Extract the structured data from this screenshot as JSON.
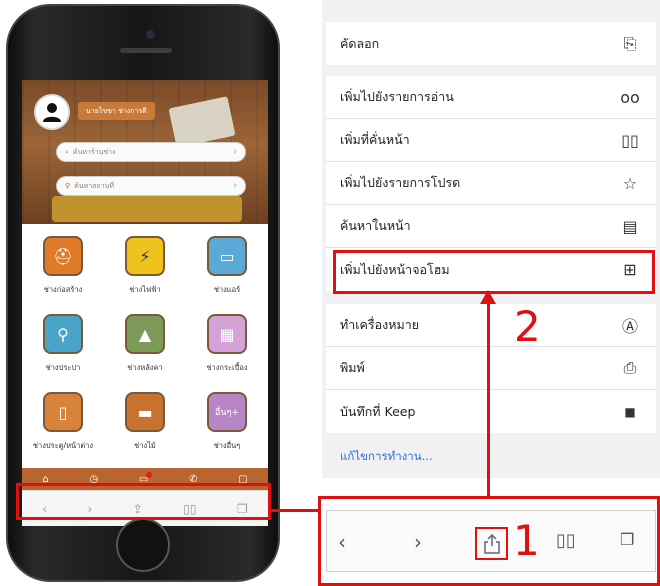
{
  "phone": {
    "user_name": "นายไขขา ช่างการดี",
    "search_shop_placeholder": "ค้นหาร้านช่าง",
    "search_location_placeholder": "ค้นหาสถานที่",
    "categories": [
      {
        "label": "ช่างก่อสร้าง",
        "icon": "helmet-icon",
        "color": "#e07b2a"
      },
      {
        "label": "ช่างไฟฟ้า",
        "icon": "lightning-icon",
        "color": "#f0c21e"
      },
      {
        "label": "ช่างแอร์",
        "icon": "air-conditioner-icon",
        "color": "#5aa9d6"
      },
      {
        "label": "ช่างประปา",
        "icon": "faucet-icon",
        "color": "#4aa3c9"
      },
      {
        "label": "ช่างหลังคา",
        "icon": "roof-icon",
        "color": "#7d9a5a"
      },
      {
        "label": "ช่างกระเบื้อง",
        "icon": "tile-icon",
        "color": "#d4a2d6"
      },
      {
        "label": "ช่างประตู/หน้าต่าง",
        "icon": "door-icon",
        "color": "#d8823a"
      },
      {
        "label": "ช่างไม้",
        "icon": "wood-icon",
        "color": "#c8722f"
      },
      {
        "label": "อื่นๆ+",
        "icon": "more-icon",
        "color": "#b886c6"
      }
    ],
    "category_bottom_label": "ช่างอื่นๆ"
  },
  "menu": {
    "items_group1": [
      {
        "label": "คัดลอก",
        "icon": "copy-icon"
      }
    ],
    "items_group2": [
      {
        "label": "เพิ่มไปยังรายการอ่าน",
        "icon": "glasses-icon"
      },
      {
        "label": "เพิ่มที่คั่นหน้า",
        "icon": "book-icon"
      },
      {
        "label": "เพิ่มไปยังรายการโปรด",
        "icon": "star-icon"
      },
      {
        "label": "ค้นหาในหน้า",
        "icon": "find-in-page-icon"
      },
      {
        "label": "เพิ่มไปยังหน้าจอโฮม",
        "icon": "add-square-icon"
      }
    ],
    "items_group3": [
      {
        "label": "ทำเครื่องหมาย",
        "icon": "markup-icon"
      },
      {
        "label": "พิมพ์",
        "icon": "printer-icon"
      },
      {
        "label": "บันทึกที่ Keep",
        "icon": "bookmark-icon"
      }
    ],
    "edit_actions": "แก้ไขการทำงาน..."
  },
  "annotations": {
    "step1": "1",
    "step2": "2"
  },
  "colors": {
    "highlight": "#e01010",
    "app_bar": "#b8652f",
    "link": "#2a6fd6"
  }
}
